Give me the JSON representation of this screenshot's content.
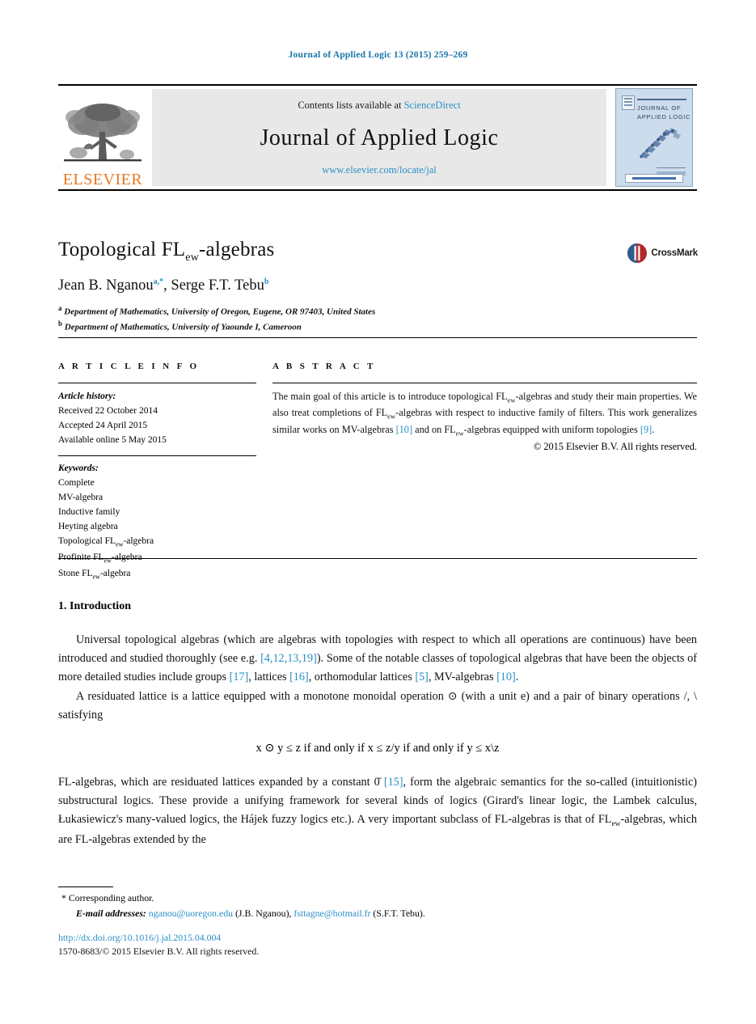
{
  "running_head": "Journal of Applied Logic 13 (2015) 259–269",
  "masthead": {
    "publisher_name": "ELSEVIER",
    "contents_prefix": "Contents lists available at ",
    "contents_link": "ScienceDirect",
    "journal_title": "Journal of Applied Logic",
    "journal_url": "www.elsevier.com/locate/jal",
    "cover_title_line1": "JOURNAL OF",
    "cover_title_line2": "APPLIED LOGIC"
  },
  "article": {
    "title_main": "Topological FL",
    "title_sub": "ew",
    "title_tail": "-algebras",
    "authors": "Jean B. Nganou",
    "author_marks_1": "a,*",
    "authors_2": ", Serge F.T. Tebu",
    "author_marks_2": "b",
    "affiliation_a_mark": "a",
    "affiliation_a": "Department of Mathematics, University of Oregon, Eugene, OR 97403, United States",
    "affiliation_b_mark": "b",
    "affiliation_b": "Department of Mathematics, University of Yaounde I, Cameroon",
    "crossmark_label": "CrossMark"
  },
  "info": {
    "heading": "A R T I C L E  I N F O",
    "history_title": "Article history:",
    "history": [
      "Received 22 October 2014",
      "Accepted 24 April 2015",
      "Available online 5 May 2015"
    ],
    "keywords_title": "Keywords:",
    "keywords": [
      "Complete",
      "MV-algebra",
      "Inductive family",
      "Heyting algebra"
    ],
    "keywords_sub": [
      {
        "pre": "Topological FL",
        "sub": "ew",
        "post": "-algebra"
      },
      {
        "pre": "Profinite FL",
        "sub": "ew",
        "post": "-algebra"
      },
      {
        "pre": "Stone FL",
        "sub": "ew",
        "post": "-algebra"
      }
    ]
  },
  "abstract": {
    "heading": "A B S T R A C T",
    "part1": "The main goal of this article is to introduce topological FL",
    "sub1": "ew",
    "part2": "-algebras and study their main properties. We also treat completions of FL",
    "sub2": "ew",
    "part3": "-algebras with respect to inductive family of filters. This work generalizes similar works on MV-algebras ",
    "ref1": "[10]",
    "part4": " and on FL",
    "sub3": "ew",
    "part5": "-algebras equipped with uniform topologies ",
    "ref2": "[9]",
    "part6": ".",
    "copyright": "© 2015 Elsevier B.V. All rights reserved."
  },
  "body": {
    "section_heading": "1. Introduction",
    "p1_a": "Universal topological algebras (which are algebras with topologies with respect to which all operations are continuous) have been introduced and studied thoroughly (see e.g. ",
    "p1_ref1": "[4,12,13,19]",
    "p1_b": "). Some of the notable classes of topological algebras that have been the objects of more detailed studies include groups ",
    "p1_ref2": "[17]",
    "p1_c": ", lattices ",
    "p1_ref3": "[16]",
    "p1_d": ", orthomodular lattices ",
    "p1_ref4": "[5]",
    "p1_e": ", MV-algebras ",
    "p1_ref5": "[10]",
    "p1_f": ".",
    "p2": "A residuated lattice is a lattice equipped with a monotone monoidal operation ⊙ (with a unit e) and a pair of binary operations /, \\ satisfying",
    "equation": "x ⊙ y ≤ z   if and only if   x ≤ z/y   if and only if   y ≤ x\\z",
    "p3_a": "FL-algebras, which are residuated lattices expanded by a constant 0̄ ",
    "p3_ref1": "[15]",
    "p3_b": ", form the algebraic semantics for the so-called (intuitionistic) substructural logics. These provide a unifying framework for several kinds of logics (Girard's linear logic, the Lambek calculus, Łukasiewicz's many-valued logics, the Hájek fuzzy logics etc.). A very important subclass of FL-algebras is that of FL",
    "p3_sub": "ew",
    "p3_c": "-algebras, which are FL-algebras extended by the"
  },
  "footer": {
    "corresponding_mark": "*",
    "corresponding": "Corresponding author.",
    "email_label": "E-mail addresses:",
    "email1": "nganou@uoregon.edu",
    "email1_owner": " (J.B. Nganou), ",
    "email2": "fsttagne@hotmail.fr",
    "email2_owner": " (S.F.T. Tebu).",
    "doi": "http://dx.doi.org/10.1016/j.jal.2015.04.004",
    "issn": "1570-8683/© 2015 Elsevier B.V. All rights reserved."
  },
  "colors": {
    "link_blue": "#2b8fc4",
    "head_blue": "#1a76a8",
    "elsevier_orange": "#e87722",
    "band_gray": "#e8e8e8",
    "cover_blue": "#cddcec"
  }
}
